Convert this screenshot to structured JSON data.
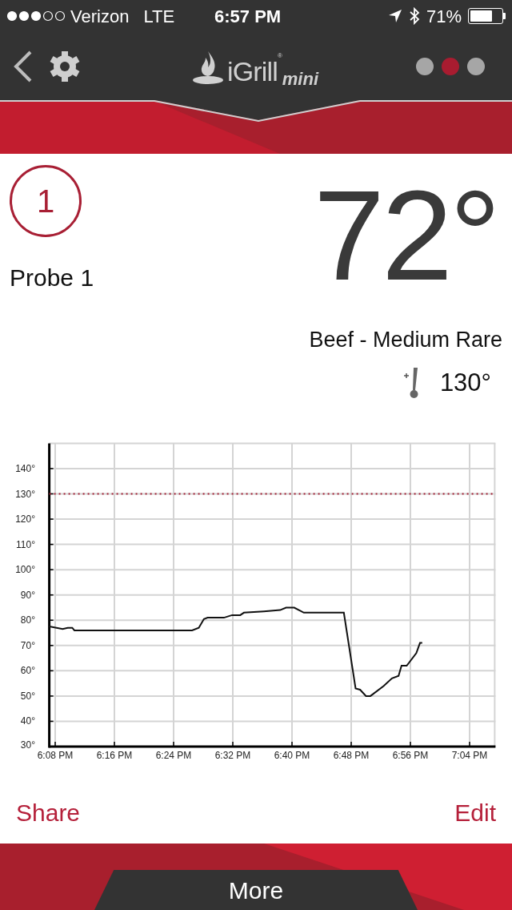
{
  "status_bar": {
    "carrier": "Verizon",
    "network": "LTE",
    "time": "6:57 PM",
    "battery": "71%"
  },
  "header": {
    "logo": {
      "name": "iGrill",
      "mark": "®",
      "suffix": "mini"
    },
    "pages": [
      {
        "selected": false
      },
      {
        "selected": true
      },
      {
        "selected": false
      }
    ]
  },
  "probe": {
    "number": "1",
    "name": "Probe 1",
    "temperature": "72°",
    "preset": "Beef - Medium Rare",
    "target": "130°"
  },
  "chart_data": {
    "type": "line",
    "xlim": [
      1087.2,
      1147.5
    ],
    "ylim": [
      30,
      150
    ],
    "xticks": [
      {
        "value": 1088,
        "label": "6:08 PM"
      },
      {
        "value": 1096,
        "label": "6:16 PM"
      },
      {
        "value": 1104,
        "label": "6:24 PM"
      },
      {
        "value": 1112,
        "label": "6:32 PM"
      },
      {
        "value": 1120,
        "label": "6:40 PM"
      },
      {
        "value": 1128,
        "label": "6:48 PM"
      },
      {
        "value": 1136,
        "label": "6:56 PM"
      },
      {
        "value": 1144,
        "label": "7:04 PM"
      }
    ],
    "yticks": [
      {
        "value": 30,
        "label": "30°"
      },
      {
        "value": 40,
        "label": "40°"
      },
      {
        "value": 50,
        "label": "50°"
      },
      {
        "value": 60,
        "label": "60°"
      },
      {
        "value": 70,
        "label": "70°"
      },
      {
        "value": 80,
        "label": "80°"
      },
      {
        "value": 90,
        "label": "90°"
      },
      {
        "value": 100,
        "label": "100°"
      },
      {
        "value": 110,
        "label": "110°"
      },
      {
        "value": 120,
        "label": "120°"
      },
      {
        "value": 130,
        "label": "130°"
      },
      {
        "value": 140,
        "label": "140°"
      }
    ],
    "x": [
      1087.2,
      1089,
      1089.7,
      1090.3,
      1090.6,
      1106.5,
      1107.4,
      1108.1,
      1108.6,
      1110.8,
      1111.9,
      1113,
      1113.5,
      1116.2,
      1118.4,
      1119.2,
      1120.3,
      1121.6,
      1124.9,
      1127,
      1128.6,
      1129.2,
      1130,
      1130.6,
      1132.4,
      1133.5,
      1134.4,
      1134.8,
      1135.5,
      1136.8,
      1137.3,
      1137.6
    ],
    "series": [
      {
        "color": "#111111",
        "values": [
          77.5,
          76.5,
          77,
          77,
          76,
          76,
          77,
          80.5,
          81,
          81,
          82,
          82,
          83,
          83.5,
          84,
          85,
          85,
          83,
          83,
          83,
          53,
          52.5,
          50,
          50,
          54,
          57,
          58,
          62,
          62,
          67,
          71,
          71
        ]
      }
    ],
    "grid": true,
    "ref_lines": [
      {
        "axis": "y",
        "value": 130,
        "color": "#a31f34"
      }
    ]
  },
  "actions": {
    "share": "Share",
    "edit": "Edit"
  },
  "footer": {
    "more": "More"
  }
}
